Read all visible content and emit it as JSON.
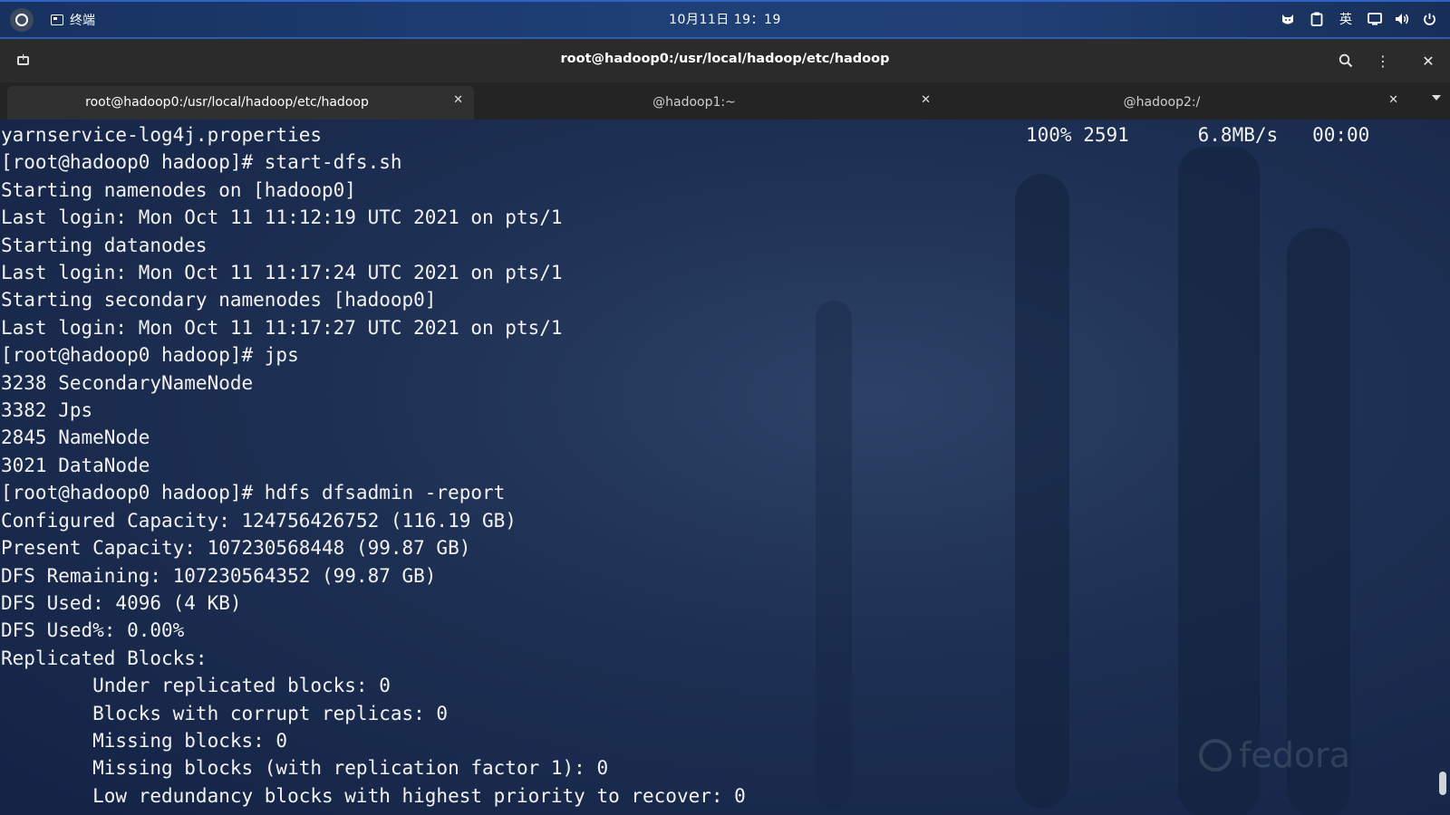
{
  "topbar": {
    "app_name": "终端",
    "clock": "10月11日 19：19",
    "input_method": "英",
    "icons": [
      "activities-icon",
      "terminal-app-icon",
      "cat-icon",
      "clipboard-icon",
      "display-icon",
      "volume-icon",
      "power-icon"
    ]
  },
  "window": {
    "title": "root@hadoop0:/usr/local/hadoop/etc/hadoop",
    "search_glyph": "⚲",
    "menu_glyph": "⋮",
    "close_glyph": "✕"
  },
  "tabs": [
    {
      "label": "root@hadoop0:/usr/local/hadoop/etc/hadoop",
      "close": "✕",
      "active": true
    },
    {
      "label": "@hadoop1:~",
      "close": "✕",
      "active": false
    },
    {
      "label": "@hadoop2:/",
      "close": "✕",
      "active": false
    }
  ],
  "terminal": {
    "progress": "100% 2591      6.8MB/s   00:00",
    "lines": [
      "yarnservice-log4j.properties",
      "[root@hadoop0 hadoop]# start-dfs.sh",
      "Starting namenodes on [hadoop0]",
      "Last login: Mon Oct 11 11:12:19 UTC 2021 on pts/1",
      "Starting datanodes",
      "Last login: Mon Oct 11 11:17:24 UTC 2021 on pts/1",
      "Starting secondary namenodes [hadoop0]",
      "Last login: Mon Oct 11 11:17:27 UTC 2021 on pts/1",
      "[root@hadoop0 hadoop]# jps",
      "3238 SecondaryNameNode",
      "3382 Jps",
      "2845 NameNode",
      "3021 DataNode",
      "[root@hadoop0 hadoop]# hdfs dfsadmin -report",
      "Configured Capacity: 124756426752 (116.19 GB)",
      "Present Capacity: 107230568448 (99.87 GB)",
      "DFS Remaining: 107230564352 (99.87 GB)",
      "DFS Used: 4096 (4 KB)",
      "DFS Used%: 0.00%",
      "Replicated Blocks:",
      "        Under replicated blocks: 0",
      "        Blocks with corrupt replicas: 0",
      "        Missing blocks: 0",
      "        Missing blocks (with replication factor 1): 0",
      "        Low redundancy blocks with highest priority to recover: 0"
    ],
    "watermark": "fedora"
  },
  "colors": {
    "topbar": "#1e4077",
    "header": "#2b2b2b",
    "tabbar": "#242424",
    "terminal_bg": "#1d2f52",
    "text": "#f2f2f2"
  }
}
